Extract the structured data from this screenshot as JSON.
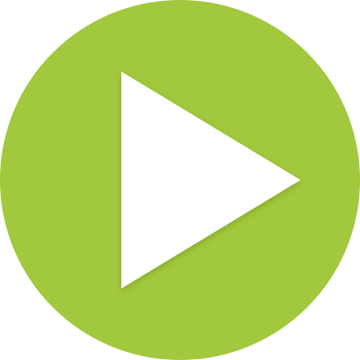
{
  "play_button": {
    "icon": "play-icon",
    "circle_color": "#A2C83D",
    "triangle_color": "#FFFFFF",
    "triangle_shadow_color": "#6E8F23"
  }
}
